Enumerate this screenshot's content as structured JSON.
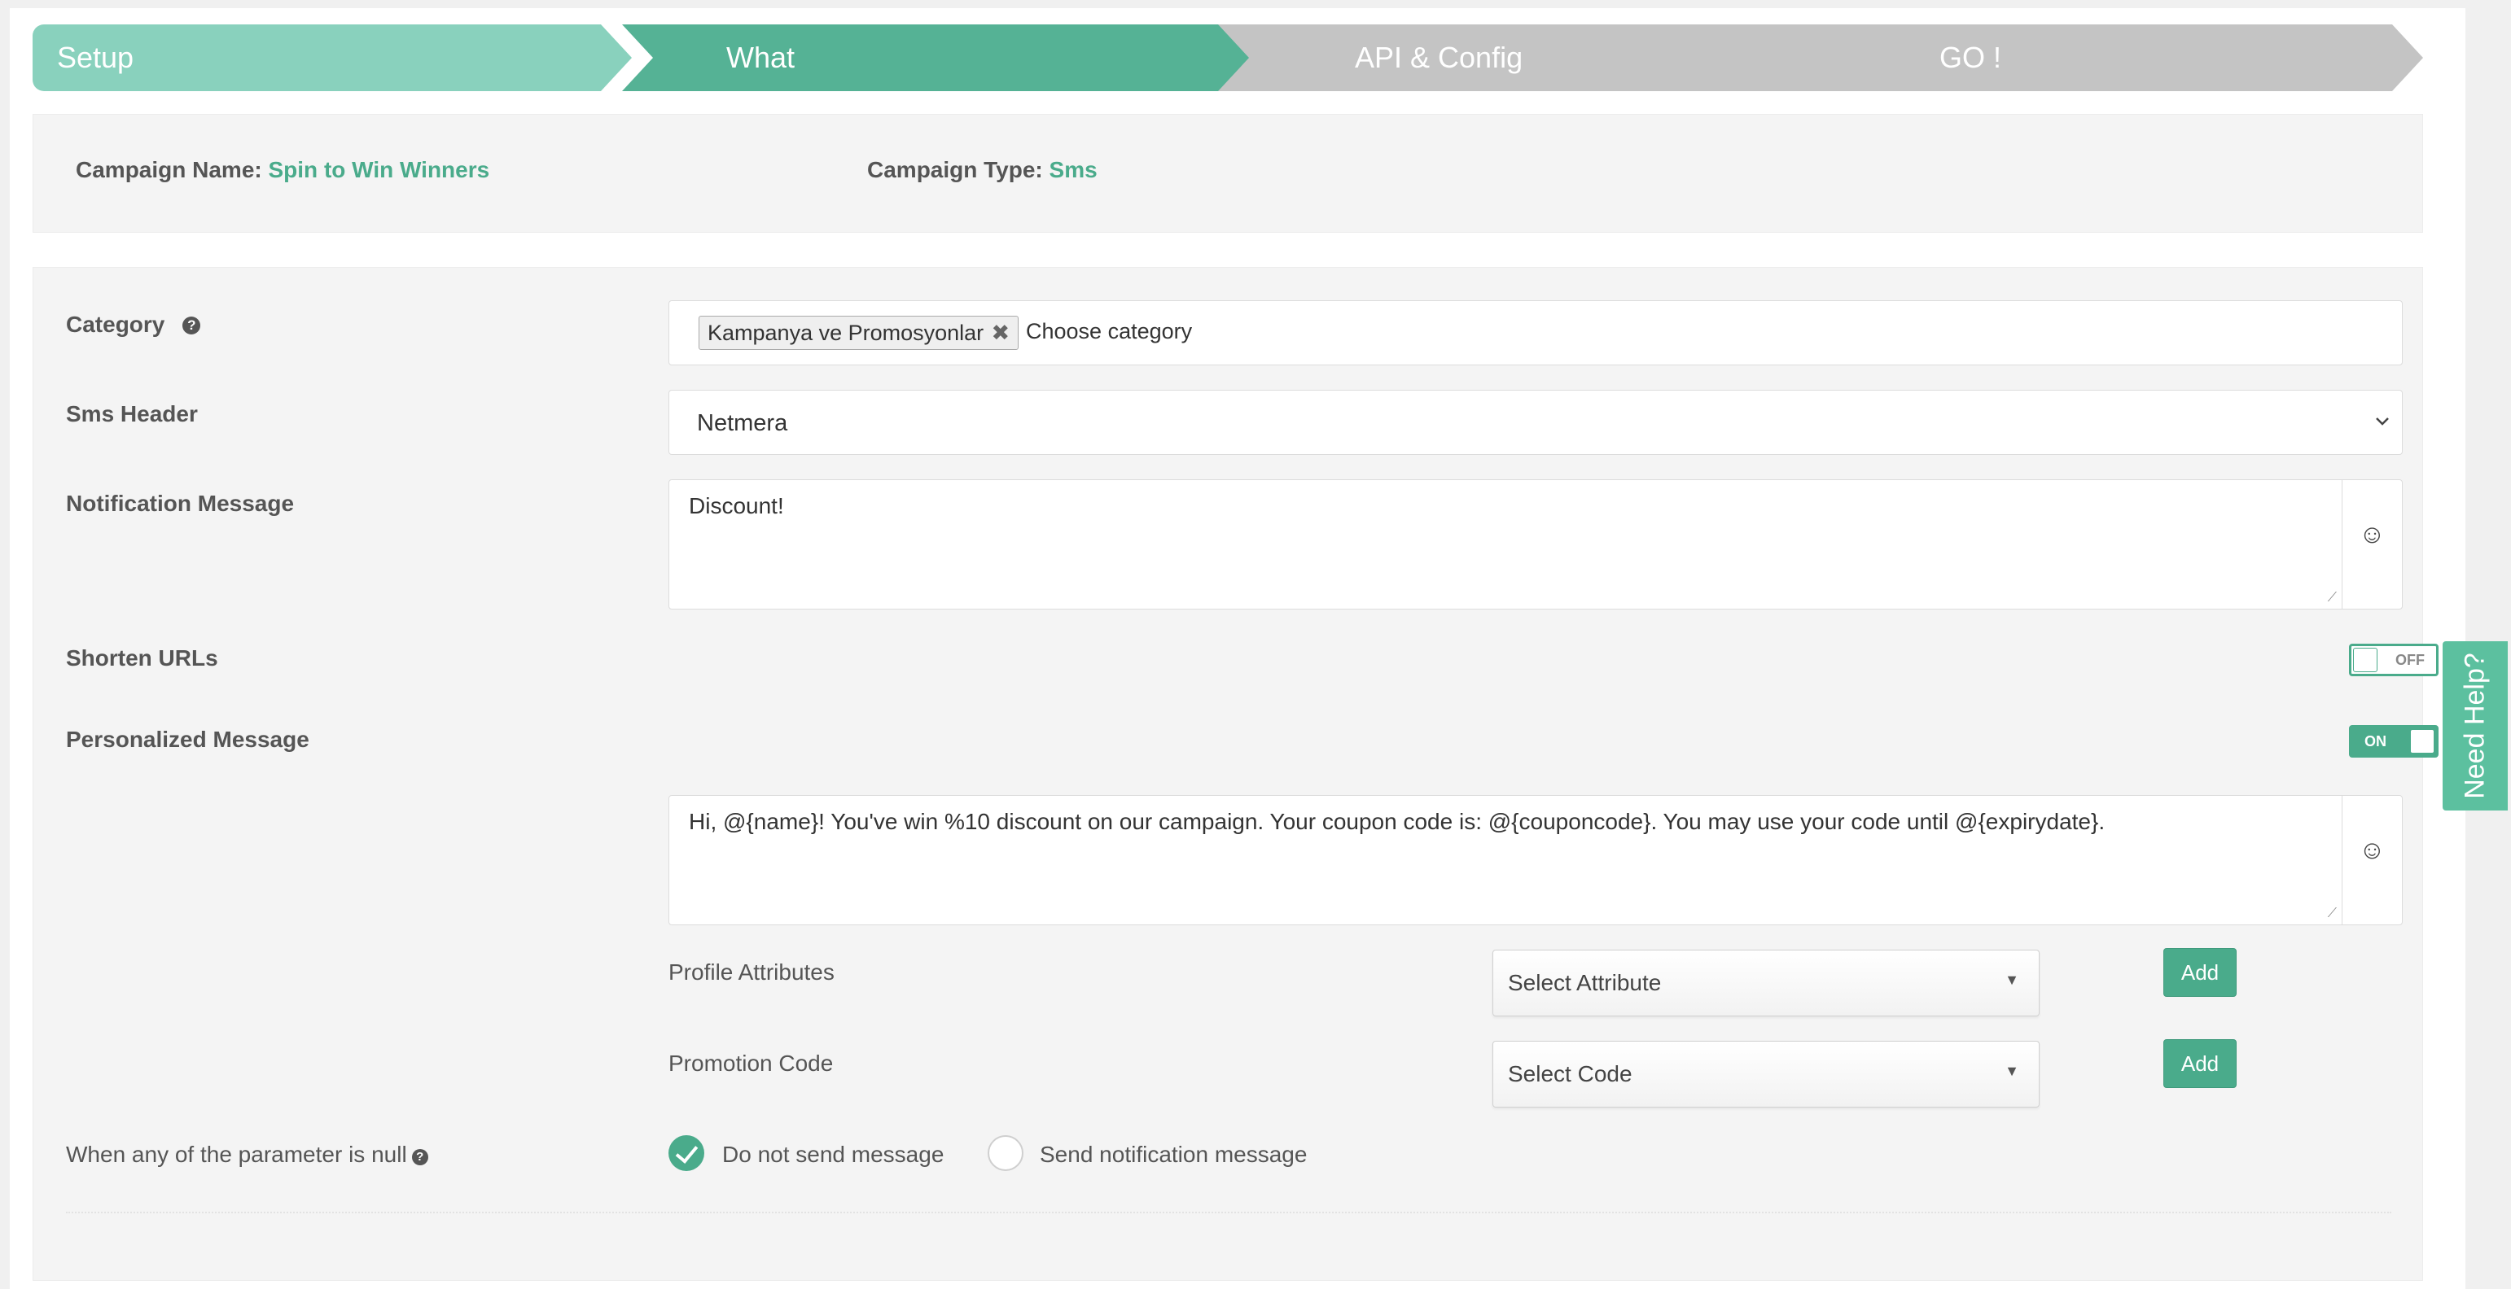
{
  "steps": [
    {
      "label": "Setup",
      "state": "done"
    },
    {
      "label": "What",
      "state": "active"
    },
    {
      "label": "API & Config",
      "state": "pending"
    },
    {
      "label": "GO !",
      "state": "pending"
    }
  ],
  "campaign": {
    "name_label": "Campaign Name:",
    "name_value": "Spin to Win Winners",
    "type_label": "Campaign Type:",
    "type_value": "Sms"
  },
  "form": {
    "category": {
      "label": "Category",
      "help_icon": "question-circle-icon",
      "selected_tag": "Kampanya ve Promosyonlar",
      "remove_glyph": "✖",
      "placeholder": "Choose category"
    },
    "sms_header": {
      "label": "Sms Header",
      "value": "Netmera"
    },
    "notification_message": {
      "label": "Notification Message",
      "value": "Discount!"
    },
    "shorten_urls": {
      "label": "Shorten URLs",
      "toggle_text": "OFF",
      "state": "off"
    },
    "personalized_message": {
      "label": "Personalized Message",
      "toggle_text": "ON",
      "state": "on",
      "value": "Hi, @{name}! You've win %10 discount on our campaign. Your coupon code is: @{couponcode}. You may use your code until @{expirydate}."
    },
    "profile_attributes": {
      "label": "Profile Attributes",
      "select_value": "Select Attribute",
      "button": "Add"
    },
    "promotion_code": {
      "label": "Promotion Code",
      "select_value": "Select Code",
      "button": "Add"
    },
    "null_param": {
      "label": "When any of the parameter is null",
      "options": [
        {
          "label": "Do not send message",
          "checked": true
        },
        {
          "label": "Send notification message",
          "checked": false
        }
      ]
    }
  },
  "need_help": "Need Help?",
  "icons": {
    "emoji": "smiley-icon",
    "dropdown": "chevron-down-icon",
    "select_arrow": "caret-down-icon"
  },
  "colors": {
    "accent": "#4aab8b",
    "step_done": "#89d1bd",
    "step_active": "#55b295",
    "step_pending": "#c4c4c4",
    "need_help_bg": "#5cc09f"
  }
}
